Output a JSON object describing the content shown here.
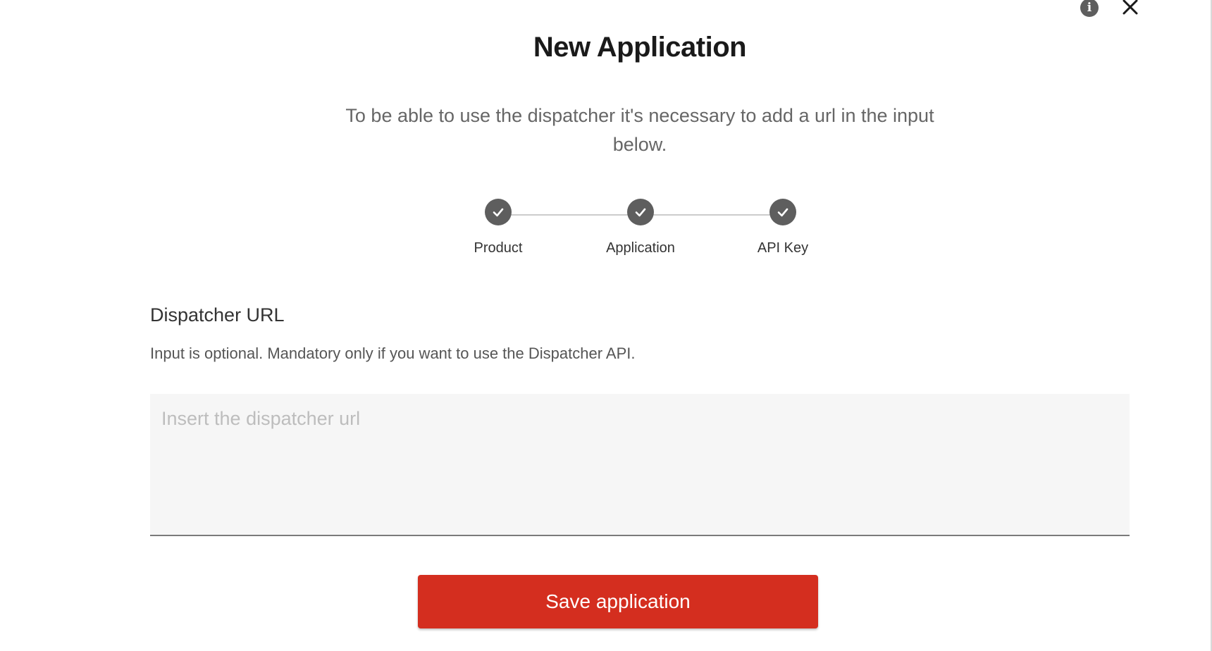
{
  "dialog": {
    "title": "New Application",
    "description": "To be able to use the dispatcher it's necessary to add a url in the input below.",
    "info_icon": "info-icon",
    "close_icon": "close-icon"
  },
  "stepper": {
    "steps": [
      {
        "label": "Product",
        "status": "completed",
        "icon": "check-icon"
      },
      {
        "label": "Application",
        "status": "completed",
        "icon": "check-icon"
      },
      {
        "label": "API Key",
        "status": "completed",
        "icon": "check-icon"
      }
    ]
  },
  "dispatcher_field": {
    "label": "Dispatcher URL",
    "hint": "Input is optional. Mandatory only if you want to use the Dispatcher API.",
    "value": "",
    "placeholder": "Insert the dispatcher url"
  },
  "actions": {
    "save_label": "Save application"
  },
  "colors": {
    "primary": "#d42e1f",
    "step_completed": "#5e5e5e",
    "input_background": "#f6f6f6"
  }
}
